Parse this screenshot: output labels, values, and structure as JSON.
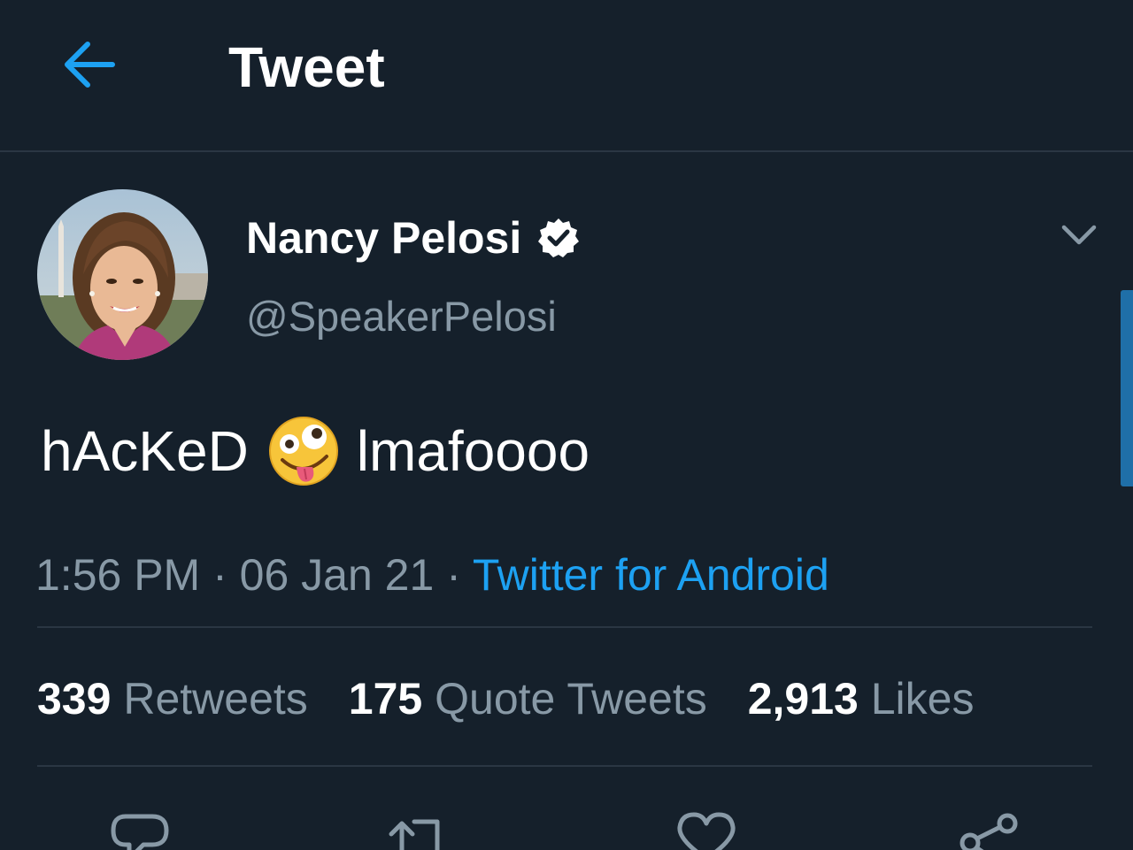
{
  "header": {
    "back_icon": "arrow-left-icon",
    "title": "Tweet"
  },
  "author": {
    "display_name": "Nancy Pelosi",
    "verified_icon": "verified-badge-icon",
    "handle": "@SpeakerPelosi",
    "avatar_icon": "avatar-photo",
    "more_icon": "chevron-down-icon"
  },
  "tweet": {
    "text_before": "hAcKeD",
    "emoji_icon": "zany-face-emoji",
    "text_after": "lmafoooo"
  },
  "meta": {
    "time": "1:56 PM",
    "separator1": " · ",
    "date": "06 Jan 21",
    "separator2": " · ",
    "source": "Twitter for Android"
  },
  "stats": {
    "retweets_count": "339",
    "retweets_label": "Retweets",
    "quotes_count": "175",
    "quotes_label": "Quote Tweets",
    "likes_count": "2,913",
    "likes_label": "Likes"
  },
  "actions": {
    "reply_icon": "reply-icon",
    "retweet_icon": "retweet-icon",
    "like_icon": "heart-icon",
    "share_icon": "share-icon"
  },
  "colors": {
    "background": "#15202b",
    "accent": "#1da1f2",
    "secondary_text": "#8899a6",
    "divider": "#2a3643"
  }
}
